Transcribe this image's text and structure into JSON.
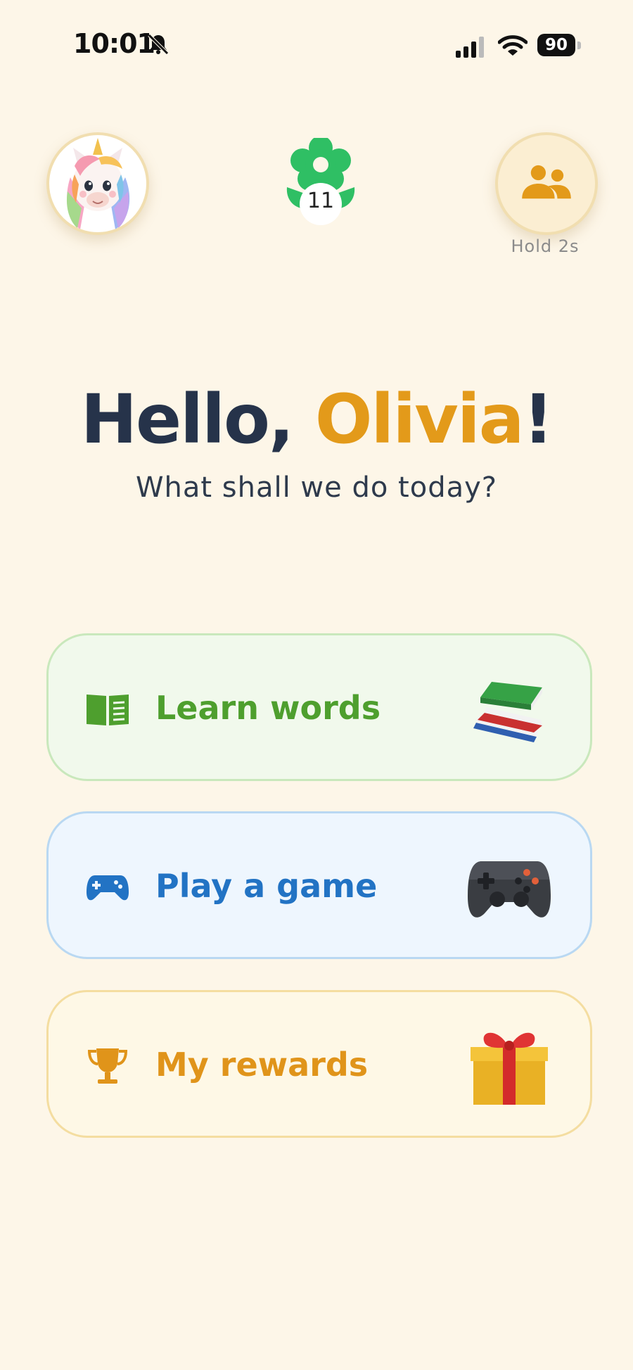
{
  "status_bar": {
    "time": "10:01",
    "battery": "90"
  },
  "header": {
    "flower_count": "11",
    "parent_hint": "Hold 2s"
  },
  "greeting": {
    "hello": "Hello, ",
    "name": "Olivia",
    "punct": "!",
    "subtitle": "What shall we do today?"
  },
  "actions": [
    {
      "label": "Learn words",
      "icon": "book-icon",
      "art": "books-stack-icon",
      "color": "#4e9f2e"
    },
    {
      "label": "Play a game",
      "icon": "gamepad-icon",
      "art": "game-controller-icon",
      "color": "#2273c4"
    },
    {
      "label": "My rewards",
      "icon": "trophy-icon",
      "art": "gift-box-icon",
      "color": "#e0941a"
    }
  ],
  "colors": {
    "background": "#fdf6e8",
    "accent": "#e39a1a",
    "text_dark": "#26334a"
  }
}
